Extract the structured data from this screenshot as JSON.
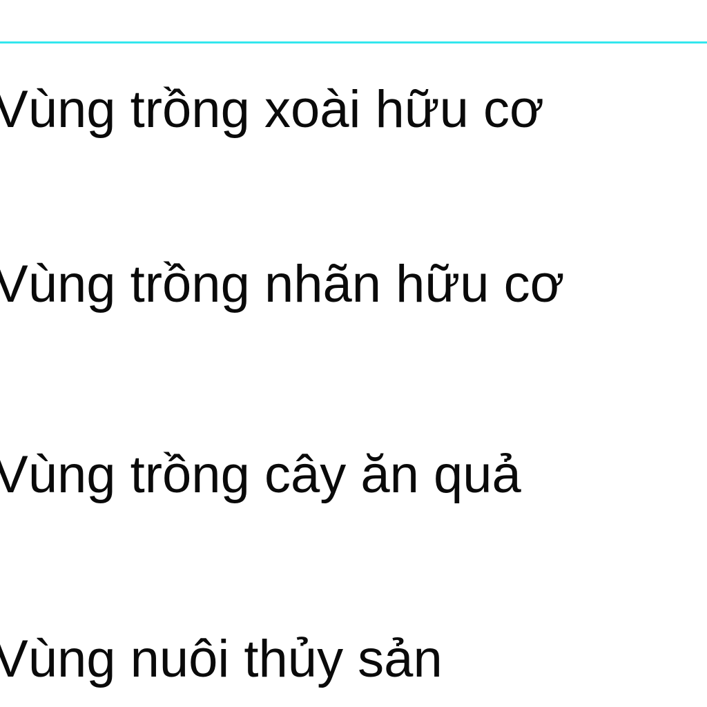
{
  "menu": {
    "items": [
      {
        "label": "Vùng trồng xoài hữu cơ"
      },
      {
        "label": "Vùng trồng nhãn hữu cơ"
      },
      {
        "label": "Vùng trồng cây ăn quả"
      },
      {
        "label": "Vùng nuôi thủy sản"
      }
    ]
  },
  "colors": {
    "divider": "#33e6ee",
    "text": "#0a0a0a",
    "background": "#ffffff"
  }
}
